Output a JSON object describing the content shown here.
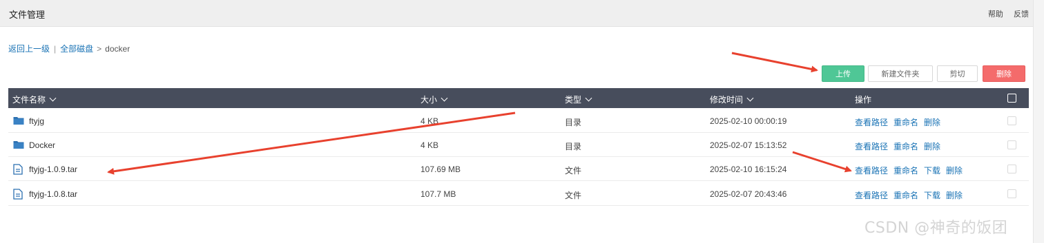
{
  "header": {
    "title": "文件管理",
    "help": "帮助",
    "feedback": "反馈"
  },
  "breadcrumb": {
    "back": "返回上一级",
    "separator": "|",
    "root": "全部磁盘",
    "arrow": ">",
    "current": "docker"
  },
  "toolbar": {
    "upload": "上传",
    "new_folder": "新建文件夹",
    "cut": "剪切",
    "delete": "删除"
  },
  "table": {
    "columns": {
      "name": "文件名称",
      "size": "大小",
      "type": "类型",
      "modified": "修改时间",
      "actions": "操作"
    },
    "rows": [
      {
        "name": "ftyjg",
        "icon": "folder-icon",
        "size": "4 KB",
        "type": "目录",
        "modified": "2025-02-10 00:00:19",
        "actions": [
          "查看路径",
          "重命名",
          "删除"
        ]
      },
      {
        "name": "Docker",
        "icon": "folder-icon",
        "size": "4 KB",
        "type": "目录",
        "modified": "2025-02-07 15:13:52",
        "actions": [
          "查看路径",
          "重命名",
          "删除"
        ]
      },
      {
        "name": "ftyjg-1.0.9.tar",
        "icon": "file-icon",
        "size": "107.69 MB",
        "type": "文件",
        "modified": "2025-02-10 16:15:24",
        "actions": [
          "查看路径",
          "重命名",
          "下载",
          "删除"
        ]
      },
      {
        "name": "ftyjg-1.0.8.tar",
        "icon": "file-icon",
        "size": "107.7 MB",
        "type": "文件",
        "modified": "2025-02-07 20:43:46",
        "actions": [
          "查看路径",
          "重命名",
          "下载",
          "删除"
        ]
      }
    ]
  },
  "watermark": "CSDN @神奇的饭团",
  "colors": {
    "header_bg": "#474d5c",
    "upload_green": "#4fc796",
    "delete_red": "#f46b6b",
    "link_blue": "#1a73b5",
    "annotation_red": "#e8412e"
  }
}
